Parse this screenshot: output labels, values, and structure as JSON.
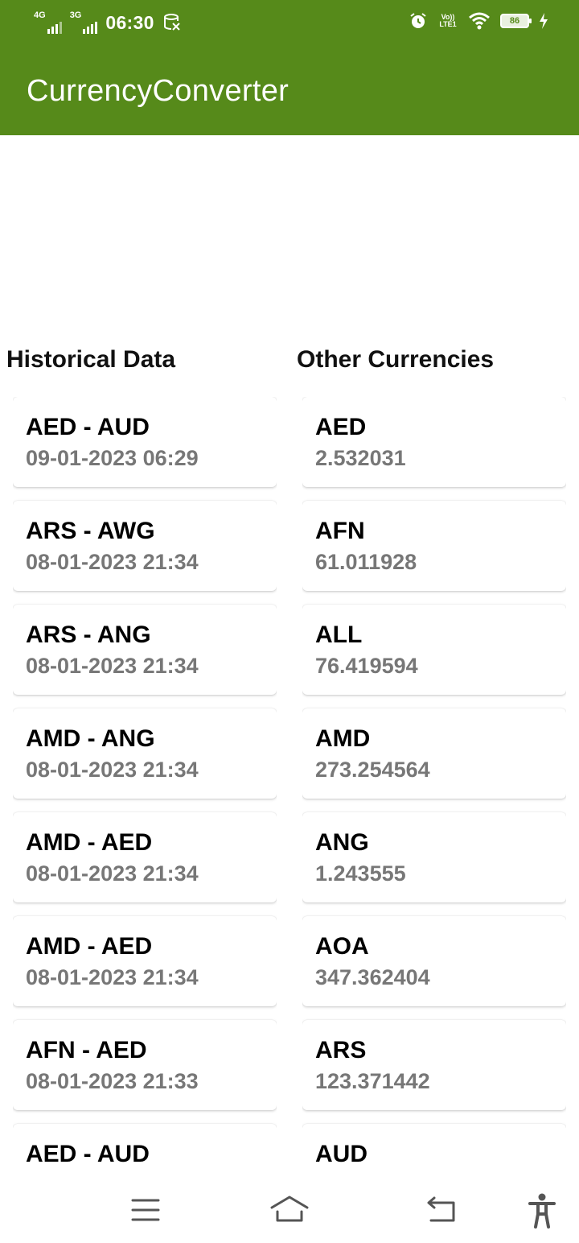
{
  "status_bar": {
    "network1": "4G",
    "network2": "3G",
    "time": "06:30",
    "volte": "Vo)) LTE1",
    "battery": "86"
  },
  "app_bar": {
    "title": "CurrencyConverter"
  },
  "historical": {
    "title": "Historical Data",
    "items": [
      {
        "pair": "AED - AUD",
        "datetime": "09-01-2023 06:29"
      },
      {
        "pair": "ARS - AWG",
        "datetime": "08-01-2023 21:34"
      },
      {
        "pair": "ARS - ANG",
        "datetime": "08-01-2023 21:34"
      },
      {
        "pair": "AMD - ANG",
        "datetime": "08-01-2023 21:34"
      },
      {
        "pair": "AMD - AED",
        "datetime": "08-01-2023 21:34"
      },
      {
        "pair": "AMD - AED",
        "datetime": "08-01-2023 21:34"
      },
      {
        "pair": "AFN - AED",
        "datetime": "08-01-2023 21:33"
      },
      {
        "pair": "AED - AUD",
        "datetime": ""
      }
    ]
  },
  "other": {
    "title": "Other Currencies",
    "items": [
      {
        "code": "AED",
        "rate": "2.532031"
      },
      {
        "code": "AFN",
        "rate": "61.011928"
      },
      {
        "code": "ALL",
        "rate": "76.419594"
      },
      {
        "code": "AMD",
        "rate": "273.254564"
      },
      {
        "code": "ANG",
        "rate": "1.243555"
      },
      {
        "code": "AOA",
        "rate": "347.362404"
      },
      {
        "code": "ARS",
        "rate": "123.371442"
      },
      {
        "code": "AUD",
        "rate": ""
      }
    ]
  },
  "navbar": {
    "icons": [
      "menu-icon",
      "home-icon",
      "back-icon",
      "accessibility-icon"
    ]
  },
  "colors": {
    "app_bar": "#568a1a",
    "secondary_text": "#777777"
  }
}
